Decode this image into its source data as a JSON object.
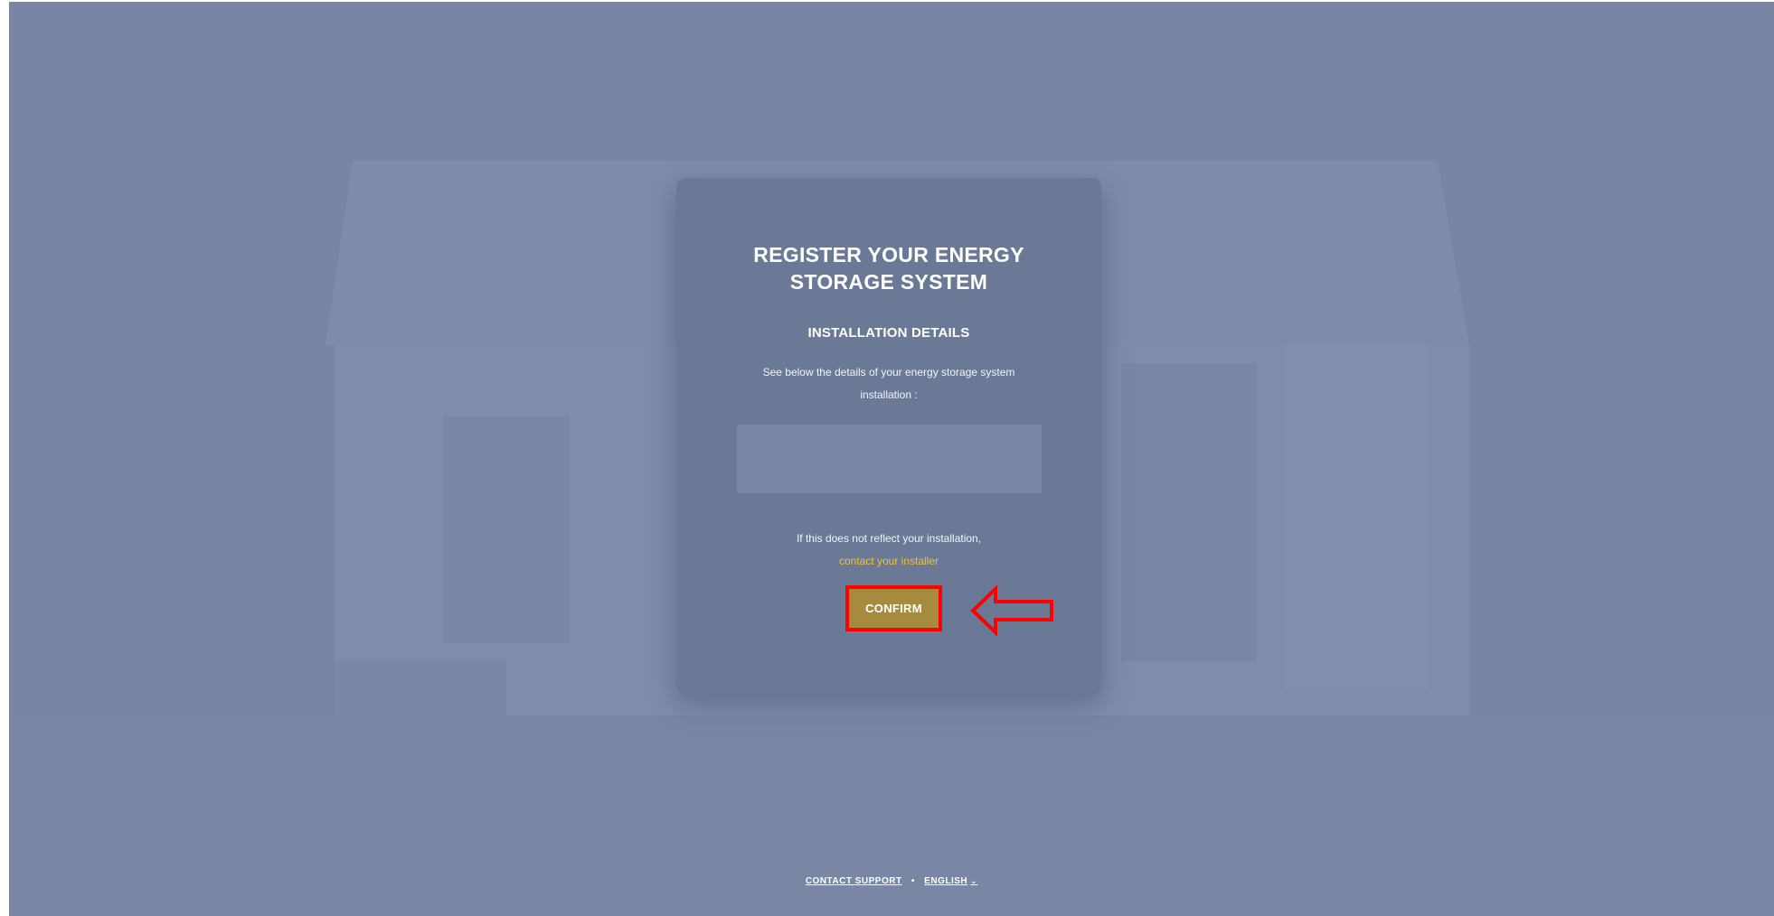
{
  "card": {
    "title": "REGISTER YOUR ENERGY STORAGE SYSTEM",
    "section_title": "INSTALLATION DETAILS",
    "description": "See below the details of your energy storage system installation :",
    "notice_text": "If this does not reflect your installation,",
    "contact_link": "contact your installer",
    "confirm_label": "CONFIRM"
  },
  "footer": {
    "contact_support": "CONTACT SUPPORT",
    "separator": "•",
    "language": "ENGLISH",
    "language_chevron": "⌄"
  },
  "colors": {
    "overlay": "#7886a4",
    "card": "#6a7996",
    "confirm_button": "#a68a3e",
    "link": "#f2c230",
    "highlight": "#ff0000"
  },
  "icons": {
    "arrow": "left-arrow-annotation-icon",
    "chevron": "chevron-down-icon"
  }
}
